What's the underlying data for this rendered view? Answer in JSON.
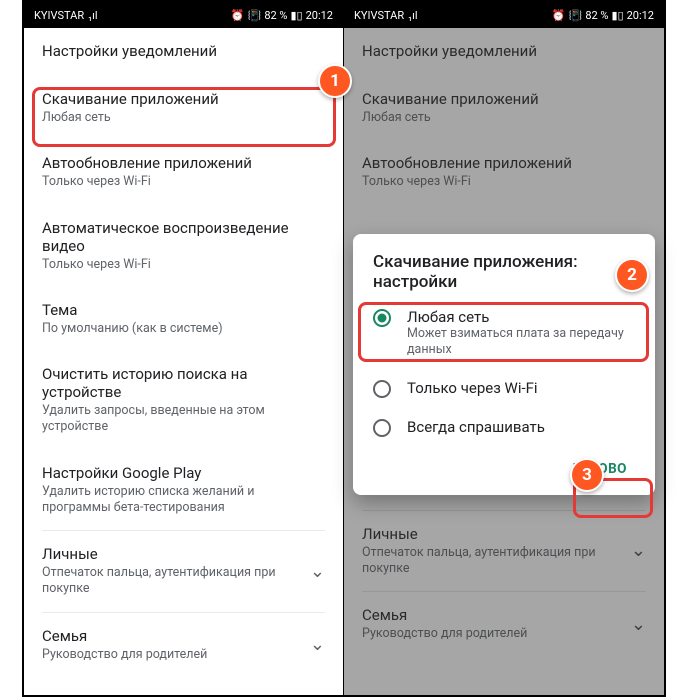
{
  "status": {
    "carrier": "KYIVSTAR",
    "signal": "₁ıl",
    "alarm": "⏰",
    "vibrate": "📳",
    "battery_pct": "82 %",
    "battery_icon": "▮▯",
    "time": "20:12"
  },
  "left": {
    "notif": "Настройки уведомлений",
    "download": {
      "title": "Скачивание приложений",
      "sub": "Любая сеть"
    },
    "autoupdate": {
      "title": "Автообновление приложений",
      "sub": "Только через Wi-Fi"
    },
    "autoplay": {
      "title": "Автоматическое воспроизведение видео",
      "sub": "Только через Wi-Fi"
    },
    "theme": {
      "title": "Тема",
      "sub": "По умолчанию (как в системе)"
    },
    "clear": {
      "title": "Очистить историю поиска на устройстве",
      "sub": "Удалить запросы, введенные на этом устройстве"
    },
    "gplay": {
      "title": "Настройки Google Play",
      "sub": "Удалить историю списка желаний и программы бета-тестирования"
    },
    "personal": {
      "title": "Личные",
      "sub": "Отпечаток пальца, аутентификация при покупке"
    },
    "family": {
      "title": "Семья",
      "sub": "Руководство для родителей"
    }
  },
  "right": {
    "autoupdate": {
      "title": "Автообновление приложений",
      "sub": "Только через Wi-Fi"
    },
    "personal": {
      "title": "Личные",
      "sub": "Отпечаток пальца, аутентификация при покупке"
    },
    "family": {
      "title": "Семья",
      "sub": "Руководство для родителей"
    }
  },
  "dialog": {
    "title": "Скачивание приложения: настройки",
    "opt1": {
      "label": "Любая сеть",
      "sub": "Может взиматься плата за передачу данных"
    },
    "opt2": {
      "label": "Только через Wi-Fi"
    },
    "opt3": {
      "label": "Всегда спрашивать"
    },
    "done": "ГОТОВО"
  },
  "badges": {
    "b1": "1",
    "b2": "2",
    "b3": "3"
  }
}
